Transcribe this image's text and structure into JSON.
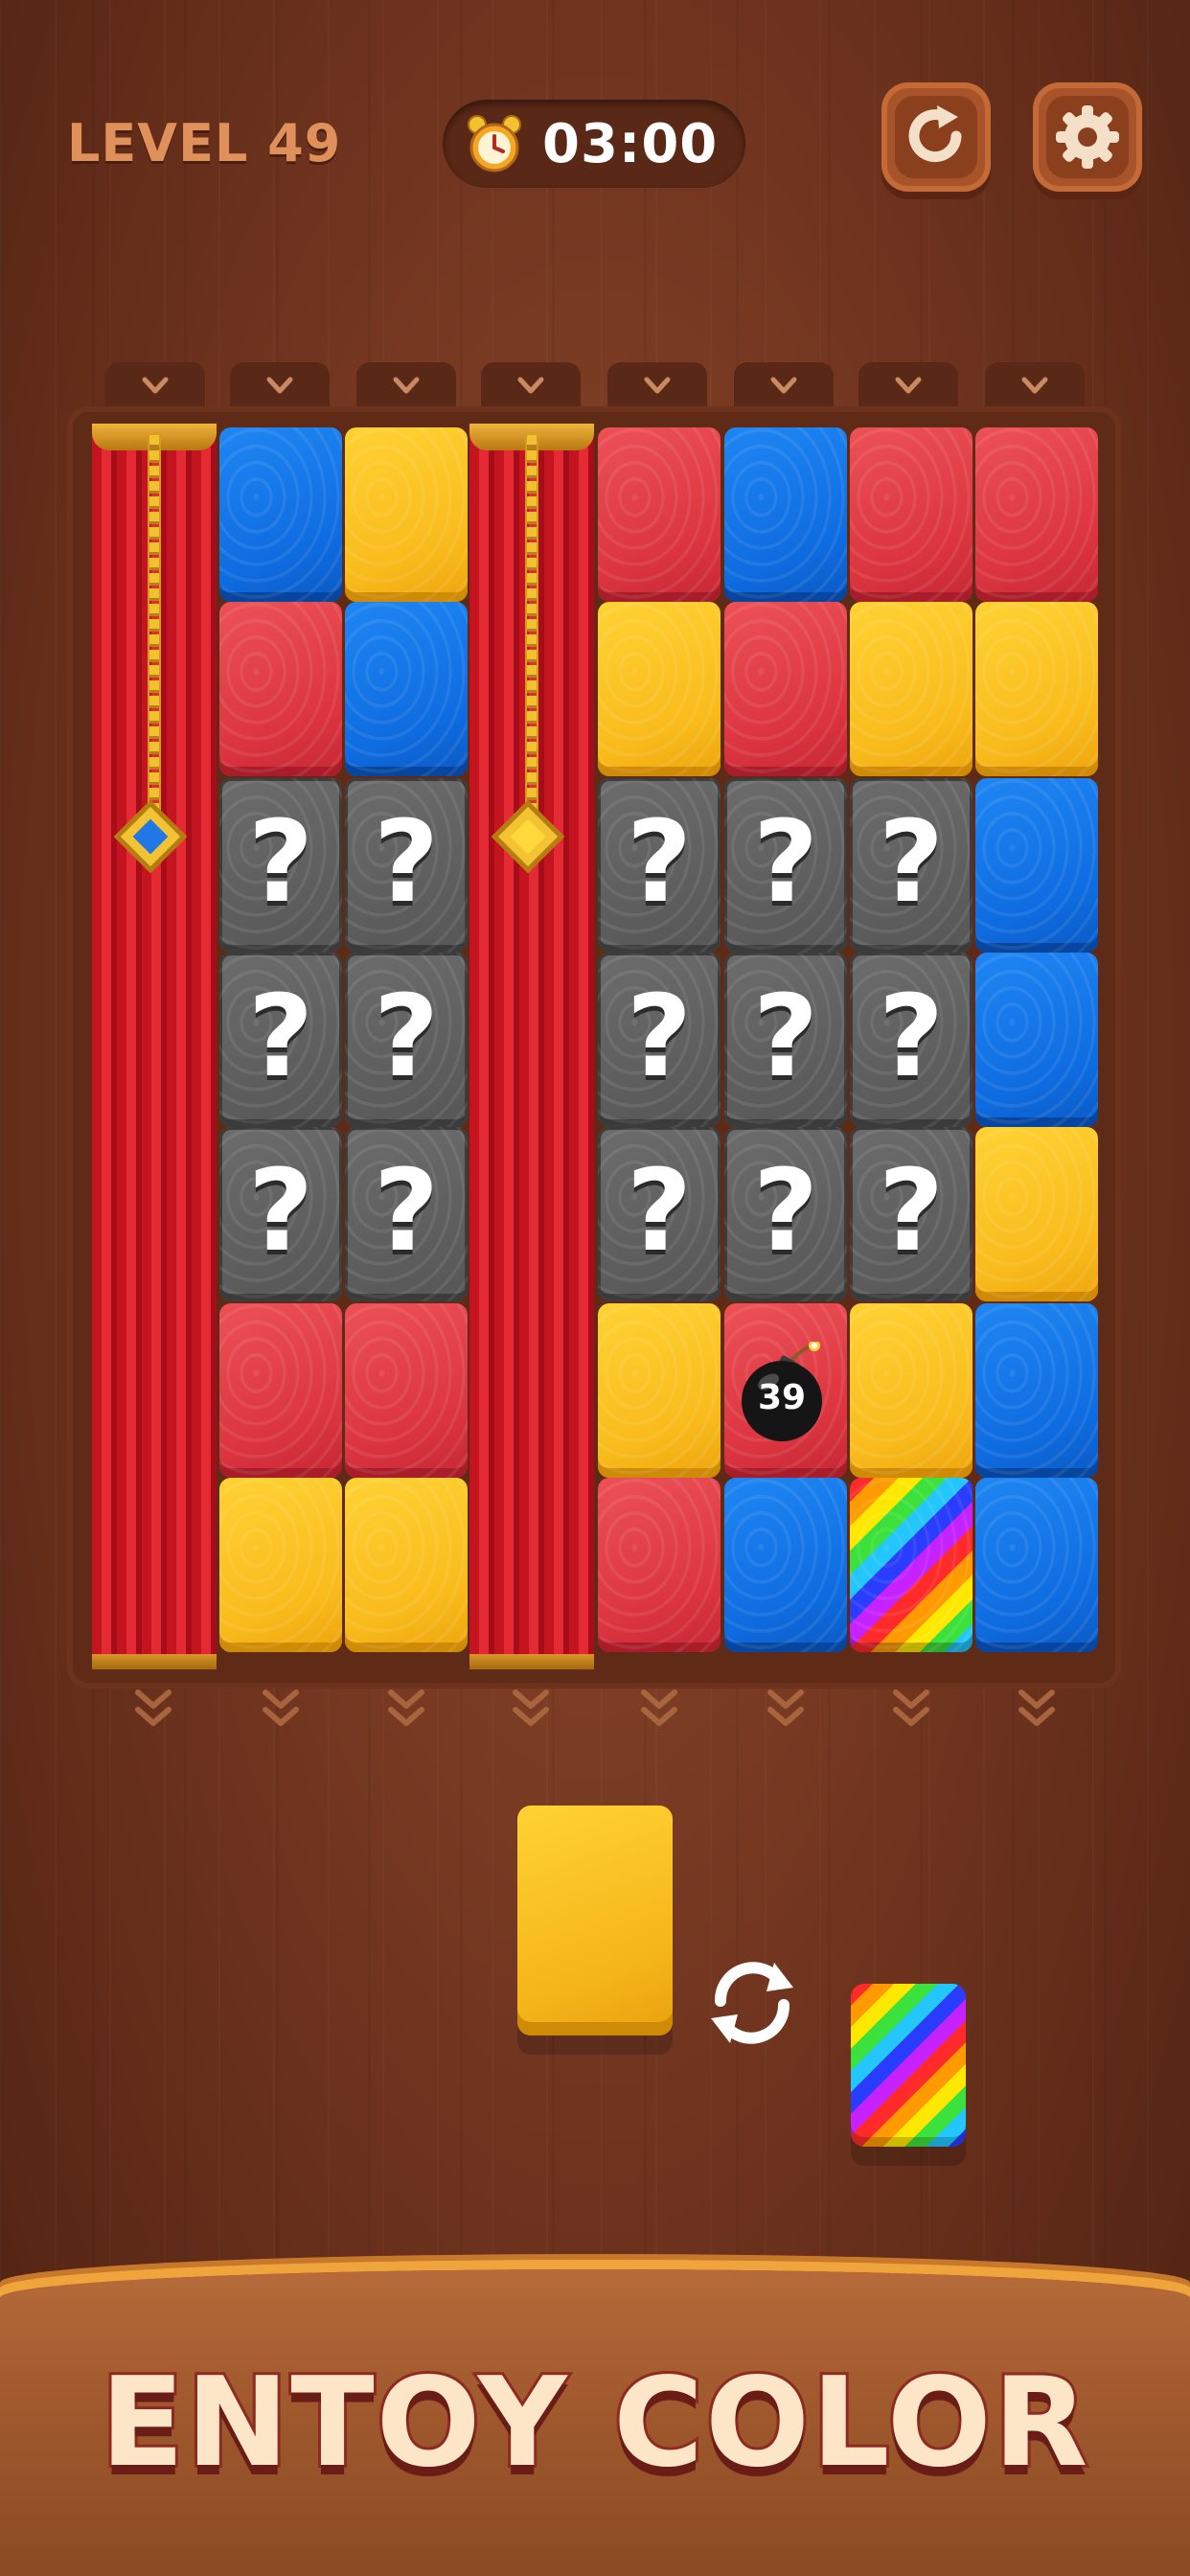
{
  "header": {
    "level_label": "LEVEL 49",
    "timer": "03:00",
    "timer_icon": "alarm-clock-icon",
    "restart_icon": "restart-icon",
    "settings_icon": "gear-icon"
  },
  "board": {
    "columns": 8,
    "rows": 7,
    "column_contents": [
      [
        "curtain"
      ],
      [
        "blue",
        "red",
        "mystery",
        "mystery",
        "mystery",
        "red",
        "yellow"
      ],
      [
        "yellow",
        "blue",
        "mystery",
        "mystery",
        "mystery",
        "red",
        "yellow"
      ],
      [
        "curtain"
      ],
      [
        "red",
        "yellow",
        "mystery",
        "mystery",
        "mystery",
        "yellow",
        "red"
      ],
      [
        "blue",
        "red",
        "mystery",
        "mystery",
        "mystery",
        "red",
        "blue"
      ],
      [
        "red",
        "yellow",
        "mystery",
        "mystery",
        "mystery",
        "yellow",
        "rainbow"
      ],
      [
        "red",
        "yellow",
        "blue",
        "blue",
        "yellow",
        "blue",
        "blue"
      ]
    ],
    "curtain_gems": [
      "blue",
      "yellow"
    ],
    "mystery_symbol": "?",
    "bomb_counter": "39"
  },
  "next_pieces": {
    "current": "yellow",
    "swap_icon": "swap-arrows-icon",
    "next": "rainbow"
  },
  "banner": {
    "title": "ENTOY COLOR"
  },
  "colors": {
    "red": "#db3440",
    "blue": "#0f6ce0",
    "yellow": "#f9bb1c",
    "mystery": "#5e5e5e"
  }
}
